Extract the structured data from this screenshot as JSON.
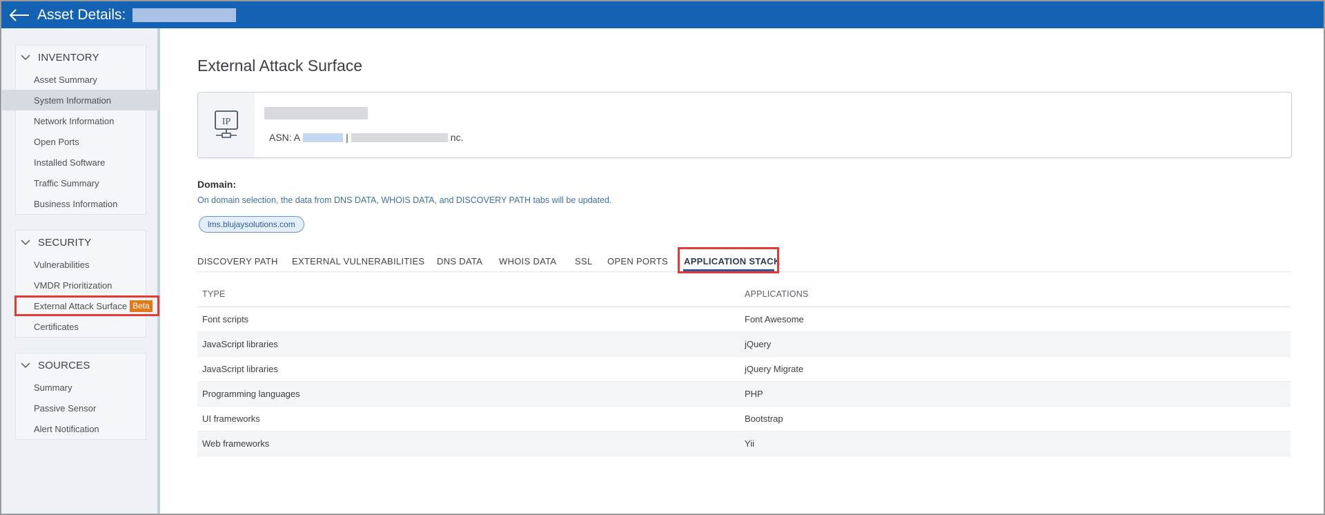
{
  "header": {
    "title": "Asset Details:"
  },
  "sidebar": {
    "sections": [
      {
        "title": "INVENTORY",
        "items": [
          "Asset Summary",
          "System Information",
          "Network Information",
          "Open Ports",
          "Installed Software",
          "Traffic Summary",
          "Business Information"
        ]
      },
      {
        "title": "SECURITY",
        "items": [
          "Vulnerabilities",
          "VMDR Prioritization",
          "External Attack Surface",
          "Certificates"
        ],
        "badge": "Beta"
      },
      {
        "title": "SOURCES",
        "items": [
          "Summary",
          "Passive Sensor",
          "Alert Notification"
        ]
      }
    ]
  },
  "main": {
    "title": "External Attack Surface",
    "asset": {
      "ip_icon_label": "IP",
      "asn_prefix": "ASN: A",
      "asn_sep": "|",
      "asn_suffix": "nc."
    },
    "domain": {
      "label": "Domain:",
      "note": "On domain selection, the data from DNS DATA, WHOIS DATA, and DISCOVERY PATH tabs will be updated.",
      "chip": "lms.blujaysolutions.com"
    },
    "tabs": [
      "DISCOVERY PATH",
      "EXTERNAL VULNERABILITIES",
      "DNS DATA",
      "WHOIS DATA",
      "SSL",
      "OPEN PORTS",
      "APPLICATION STACK"
    ],
    "active_tab": "APPLICATION STACK",
    "table": {
      "headers": [
        "TYPE",
        "APPLICATIONS"
      ],
      "rows": [
        [
          "Font scripts",
          "Font Awesome"
        ],
        [
          "JavaScript libraries",
          "jQuery"
        ],
        [
          "JavaScript libraries",
          "jQuery Migrate"
        ],
        [
          "Programming languages",
          "PHP"
        ],
        [
          "UI frameworks",
          "Bootstrap"
        ],
        [
          "Web frameworks",
          "Yii"
        ]
      ]
    }
  },
  "colors": {
    "header_bg": "#1462b4",
    "highlight_red": "#e53935",
    "beta_orange": "#e07a16"
  }
}
